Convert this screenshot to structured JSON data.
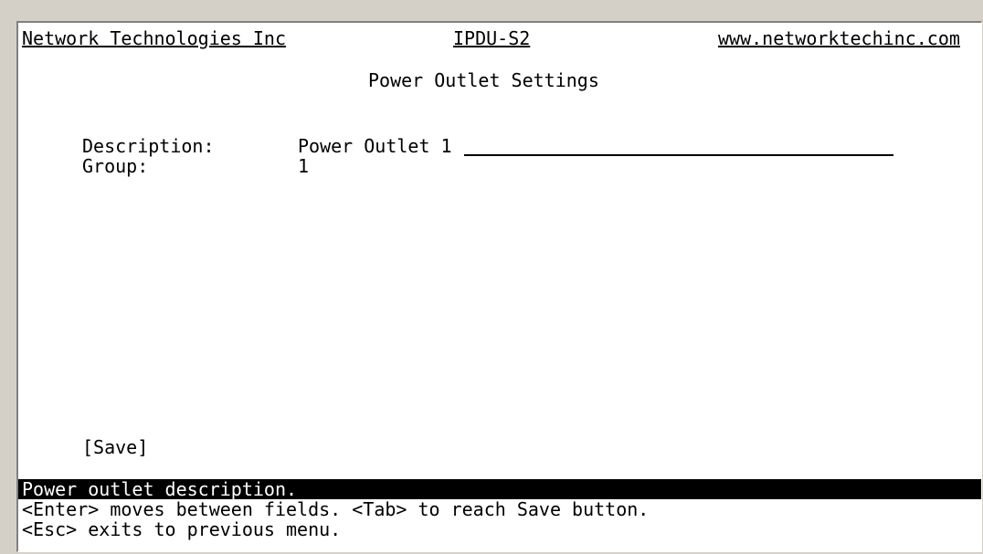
{
  "header": {
    "company": "Network Technologies Inc",
    "model": "IPDU-S2",
    "website": "www.networktechinc.com"
  },
  "page_title": "Power Outlet Settings",
  "fields": {
    "description_label": "Description:",
    "description_value": "Power Outlet 1",
    "group_label": "Group:",
    "group_value": "1"
  },
  "save_label": "[Save]",
  "status_line": "Power outlet description.",
  "help": {
    "line1": "<Enter> moves between fields. <Tab> to reach Save button.",
    "line2": "<Esc> exits to previous menu."
  }
}
